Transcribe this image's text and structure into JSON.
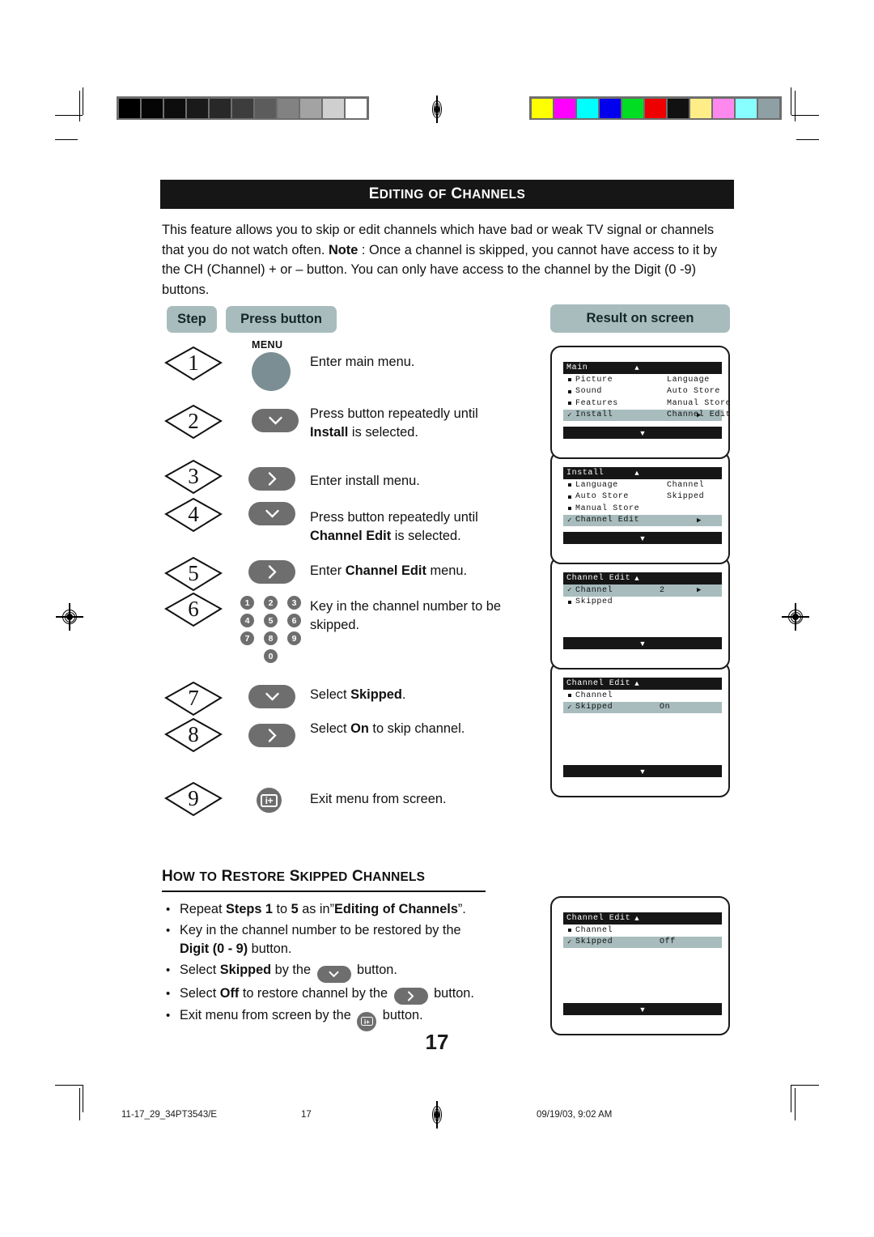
{
  "page": {
    "title": "EDITING OF CHANNELS",
    "title_parts": {
      "lead1": "E",
      "rest1": "DITING",
      "mid": "OF",
      "lead2": "C",
      "rest2": "HANNELS"
    },
    "number": "17",
    "intro": "This feature allows you to skip or edit channels which have bad or weak TV signal or channels that you do not watch often. Note : Once a channel is skipped, you cannot have access to it by the CH (Channel) + or – button. You can only have access to the channel by the Digit (0 -9) buttons.",
    "intro_bold_word": "Note"
  },
  "columns": {
    "step": "Step",
    "press_button": "Press button",
    "result_on_screen": "Result on screen"
  },
  "steps": [
    {
      "n": "1",
      "button": "menu-round",
      "button_label": "MENU",
      "text": "Enter main menu.",
      "text2": ""
    },
    {
      "n": "2",
      "button": "down-pill",
      "text": "Press button repeatedly until",
      "text2": "Install is selected.",
      "bold2": "Install"
    },
    {
      "n": "3",
      "button": "right-pill",
      "text": "Enter install menu.",
      "text2": ""
    },
    {
      "n": "4",
      "button": "down-pill",
      "text": "Press button repeatedly until",
      "text2": "Channel Edit is selected.",
      "bold2": "Channel Edit"
    },
    {
      "n": "5",
      "button": "right-pill",
      "text": "Enter Channel Edit menu.",
      "bold_in_text": "Channel Edit"
    },
    {
      "n": "6",
      "button": "digits",
      "text": "Key in the channel number to be",
      "text2": "skipped."
    },
    {
      "n": "7",
      "button": "down-pill",
      "text": "Select Skipped.",
      "bold_in_text": "Skipped"
    },
    {
      "n": "8",
      "button": "right-pill",
      "text": "Select On to skip channel.",
      "bold_in_text": "On"
    },
    {
      "n": "9",
      "button": "info-round",
      "text": "Exit menu from screen."
    }
  ],
  "digits": [
    "1",
    "2",
    "3",
    "4",
    "5",
    "6",
    "7",
    "8",
    "9",
    "0"
  ],
  "screens": [
    {
      "title": "Main",
      "rows": [
        {
          "mark": "square",
          "label": "Picture",
          "value": "",
          "arrow": "",
          "selected": false
        },
        {
          "mark": "square",
          "label": "Sound",
          "value": "",
          "arrow": "",
          "selected": false
        },
        {
          "mark": "square",
          "label": "Features",
          "value": "",
          "arrow": "",
          "selected": false
        },
        {
          "mark": "check",
          "label": "Install",
          "value": "",
          "arrow": "▶",
          "selected": true
        }
      ],
      "col2": [
        "Language",
        "Auto Store",
        "Manual Store",
        "Channel Edit"
      ],
      "bottom_arrow": "▼",
      "top_arrow": "▲"
    },
    {
      "title": "Install",
      "rows": [
        {
          "mark": "square",
          "label": "Language",
          "value": "",
          "arrow": "",
          "selected": false
        },
        {
          "mark": "square",
          "label": "Auto Store",
          "value": "",
          "arrow": "",
          "selected": false
        },
        {
          "mark": "square",
          "label": "Manual Store",
          "value": "",
          "arrow": "",
          "selected": false
        },
        {
          "mark": "check",
          "label": "Channel Edit",
          "value": "",
          "arrow": "▶",
          "selected": true
        }
      ],
      "col2": [
        "Channel",
        "Skipped"
      ],
      "bottom_arrow": "▼",
      "top_arrow": "▲"
    },
    {
      "title": "Channel Edit",
      "rows": [
        {
          "mark": "check",
          "label": "Channel",
          "value": "2",
          "arrow": "▶",
          "selected": true
        },
        {
          "mark": "square",
          "label": "Skipped",
          "value": "",
          "arrow": "",
          "selected": false
        }
      ],
      "col2": [],
      "bottom_arrow": "▼",
      "top_arrow": "▲"
    },
    {
      "title": "Channel Edit",
      "rows": [
        {
          "mark": "square",
          "label": "Channel",
          "value": "",
          "arrow": "",
          "selected": false
        },
        {
          "mark": "check",
          "label": "Skipped",
          "value": "On",
          "arrow": "",
          "selected": true
        }
      ],
      "col2": [],
      "bottom_arrow": "▼",
      "top_arrow": "▲"
    }
  ],
  "restore": {
    "heading": "HOW TO RESTORE SKIPPED CHANNELS",
    "heading_parts": {
      "h1": "H",
      "h1r": "OW",
      "h2": "TO",
      "h3": "R",
      "h3r": "ESTORE",
      "h4": "S",
      "h4r": "KIPPED",
      "h5": "C",
      "h5r": "HANNELS"
    },
    "bullets": [
      "Repeat Steps 1 to 5 as in”Editing of Channels”.",
      "Key in the channel number to be restored by the Digit (0 - 9) button.",
      "Select Skipped by the ∨ button.",
      "Select Off to restore channel by the › button.",
      "Exit menu from screen by the i+ button."
    ],
    "screen": {
      "title": "Channel Edit",
      "rows": [
        {
          "mark": "square",
          "label": "Channel",
          "value": "",
          "arrow": "",
          "selected": false
        },
        {
          "mark": "check",
          "label": "Skipped",
          "value": "Off",
          "arrow": "",
          "selected": true
        }
      ],
      "bottom_arrow": "▼",
      "top_arrow": "▲"
    }
  },
  "footer": {
    "left": "11-17_29_34PT3543/E",
    "center": "17",
    "right": "09/19/03, 9:02 AM"
  },
  "colors": {
    "accent_pill": "#a8bcbd",
    "button_gray": "#6e6e6e",
    "menu_button": "#7b8e93",
    "osd_black": "#161616",
    "grayscale_bar": [
      "#000000",
      "#050505",
      "#0d0d0d",
      "#1a1a1a",
      "#282828",
      "#3d3d3d",
      "#5c5c5c",
      "#828282",
      "#a3a3a3",
      "#cfcfcf",
      "#ffffff"
    ],
    "color_bar": [
      "#ffff00",
      "#ff00ff",
      "#00ffff",
      "#0000ee",
      "#00dd22",
      "#ee0000",
      "#111111",
      "#ffee88",
      "#ff88ee",
      "#88ffff",
      "#8fa0a4"
    ]
  }
}
